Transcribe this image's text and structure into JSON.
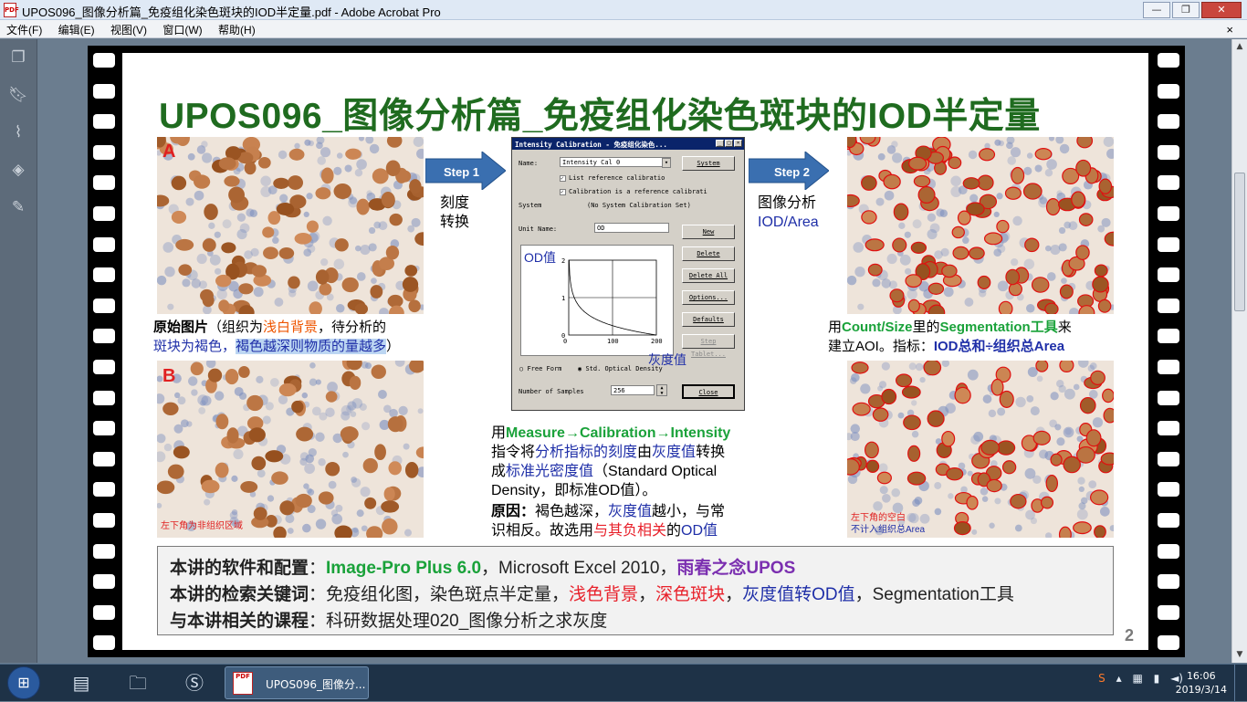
{
  "window": {
    "title": "UPOS096_图像分析篇_免疫组化染色斑块的IOD半定量.pdf - Adobe Acrobat Pro",
    "pdf_icon": "PDF",
    "minimize": "—",
    "restore": "❐",
    "close": "✕"
  },
  "menu": {
    "items": [
      "文件(F)",
      "编辑(E)",
      "视图(V)",
      "窗口(W)",
      "帮助(H)"
    ],
    "close_doc": "×"
  },
  "left_panel": {
    "icons": [
      "pages-icon",
      "bookmarks-icon",
      "attachments-icon",
      "layers-icon",
      "signatures-icon"
    ]
  },
  "slide": {
    "title": "UPOS096_图像分析篇_免疫组化染色斑块的IOD半定量",
    "panel_a_letter": "A",
    "panel_b_letter": "B",
    "caption_a": {
      "l1_a": "原始图片",
      "l1_b": "（组织为",
      "l1_c": "浅白背景",
      "l1_d": "，待分析的",
      "l2_a": "斑块为褐色，",
      "l2_b": "褐色越深则物质的量越多",
      "l2_c": "）"
    },
    "caption_b_note": "左下角为非组织区域",
    "step1": {
      "label": "Step 1",
      "l1": "刻度",
      "l2": "转换"
    },
    "step2": {
      "label": "Step 2",
      "l1": "图像分析",
      "l2": "IOD/Area"
    },
    "right_caption": {
      "l1_a": "用",
      "l1_b": "Count/Size",
      "l1_c": "里的",
      "l1_d": "Segmentation工具",
      "l1_e": "来",
      "l2_a": "建立AOI。指标：",
      "l2_b": "IOD总和÷组织总Area"
    },
    "right_note": {
      "l1": "左下角的空白",
      "l2": "不计入组织总Area"
    },
    "dialog": {
      "title": "Intensity Calibration - 免疫组化染色...",
      "name_label": "Name:",
      "name_value": "Intensity Cal 0",
      "system_btn": "System",
      "chk1": "List reference calibratio",
      "chk2": "Calibration is a reference calibrati",
      "system_label": "System",
      "system_value": "(No System Calibration Set)",
      "unit_label": "Unit Name:",
      "unit_value": "OD",
      "btn_new": "New",
      "btn_delete": "Delete",
      "btn_delete_all": "Delete All",
      "btn_options": "Options...",
      "btn_defaults": "Defaults",
      "btn_step": "Step Tablet...",
      "y_axis_label": "OD值",
      "x_axis_label": "灰度值",
      "y_ticks": [
        "2",
        "1",
        "0"
      ],
      "x_ticks": [
        "0",
        "100",
        "200"
      ],
      "radio1": "Free Form",
      "radio2": "Std. Optical Density",
      "samples_label": "Number of Samples",
      "samples_value": "256",
      "btn_close": "Close"
    },
    "mid_caption": {
      "l1_a": "用",
      "l1_b": "Measure→Calibration→Intensity",
      "l2_a": "指令将",
      "l2_b": "分析指标的刻度",
      "l2_c": "由",
      "l2_d": "灰度值",
      "l2_e": "转换",
      "l3_a": "成",
      "l3_b": "标准光密度值",
      "l3_c": "（Standard Optical",
      "l4": "Density，即标准OD值）。",
      "l5_a": "原因：",
      "l5_b": "褐色越深，",
      "l5_c": "灰度值",
      "l5_d": "越小，与常",
      "l6_a": "识相反。故选用",
      "l6_b": "与其负相关",
      "l6_c": "的",
      "l6_d": "OD值"
    },
    "bottom": {
      "r1_label": "本讲的软件和配置",
      "r1_colon": "：",
      "r1_a": "Image-Pro Plus 6.0",
      "r1_b": "，Microsoft Excel 2010，",
      "r1_c": "雨春之念UPOS",
      "r2_label": "本讲的检索关键词",
      "r2_colon": "：",
      "r2_a": "免疫组化图，染色斑点半定量，",
      "r2_b": "浅色背景",
      "r2_c": "，",
      "r2_d": "深色斑块",
      "r2_e": "，",
      "r2_f": "灰度值转OD值",
      "r2_g": "，Segmentation工具",
      "r3_label": "与本讲相关的课程",
      "r3_colon": "：",
      "r3_a": "科研数据处理020_图像分析之求灰度"
    },
    "page_number": "2"
  },
  "taskbar": {
    "task_label": "UPOS096_图像分...",
    "time": "16:06",
    "date": "2019/3/14",
    "tray_icons": [
      "sogou-icon",
      "show-hidden-icon",
      "network-icon",
      "battery-icon",
      "volume-icon"
    ]
  },
  "colors": {
    "title_green": "#1f6b1f",
    "accent_blue": "#1f2fa8",
    "accent_red": "#e8202a",
    "accent_orange": "#ee5500",
    "accent_green": "#1aa23a",
    "accent_purple": "#7b2fb0"
  }
}
